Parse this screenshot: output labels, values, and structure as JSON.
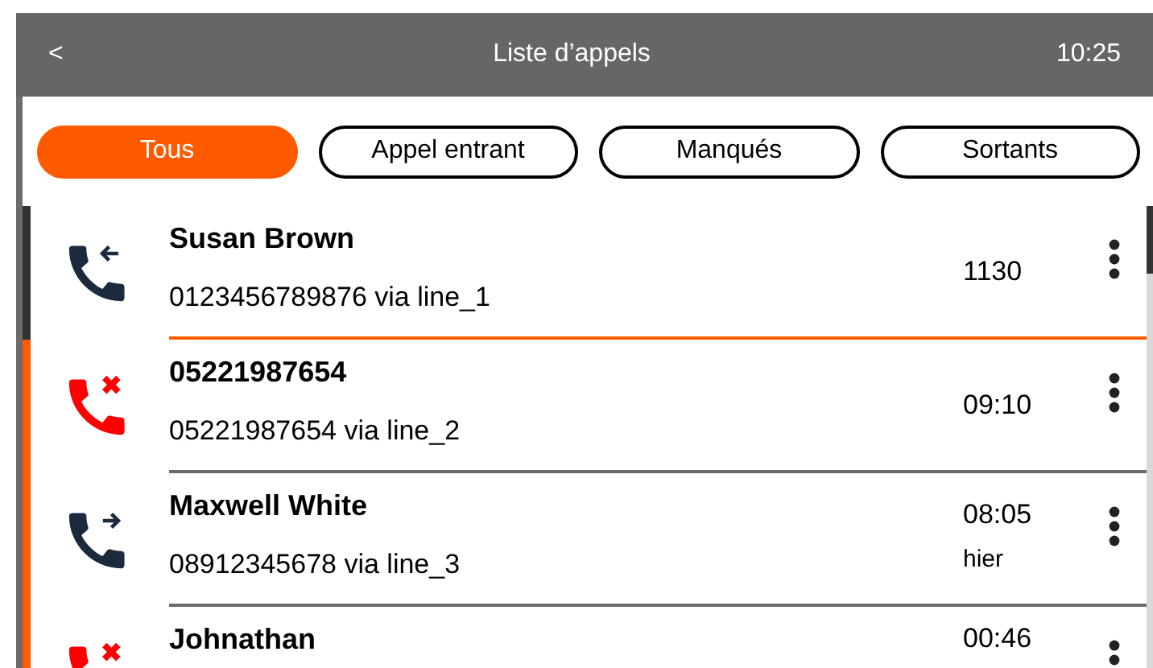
{
  "header": {
    "back": "<",
    "title": "Liste d’appels",
    "time": "10:25"
  },
  "filters": [
    {
      "label": "Tous",
      "selected": true
    },
    {
      "label": "Appel entrant",
      "selected": false
    },
    {
      "label": "Manqués",
      "selected": false
    },
    {
      "label": "Sortants",
      "selected": false
    }
  ],
  "calls": [
    {
      "kind": "incoming",
      "name": "Susan Brown",
      "detail": "0123456789876 via line_1",
      "time": "1130",
      "selected": true
    },
    {
      "kind": "missed",
      "name": "05221987654",
      "detail": "05221987654 via line_2",
      "time": "09:10",
      "selected": false
    },
    {
      "kind": "outgoing",
      "name": "Maxwell White",
      "detail": "08912345678 via line_3",
      "time": "08:05",
      "day": "hier",
      "selected": false
    },
    {
      "kind": "missed",
      "name": "Johnathan",
      "time": "00:46",
      "selected": false
    }
  ]
}
